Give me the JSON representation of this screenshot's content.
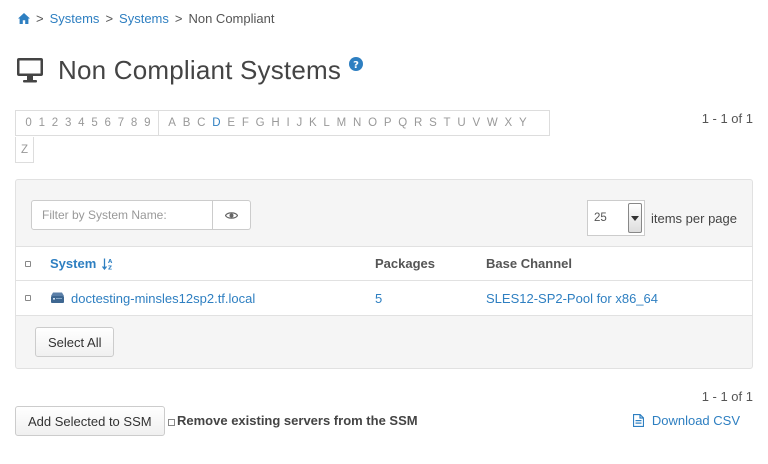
{
  "breadcrumb": {
    "home_icon": "home-icon",
    "sep1": ">",
    "item1": "Systems",
    "sep2": ">",
    "item2": "Systems",
    "sep3": ">",
    "current": "Non Compliant"
  },
  "header": {
    "icon": "desktop-icon",
    "title": "Non Compliant Systems",
    "help_icon": "question-circle-icon"
  },
  "alphabar": {
    "digits": [
      "0",
      "1",
      "2",
      "3",
      "4",
      "5",
      "6",
      "7",
      "8",
      "9"
    ],
    "letters": [
      "A",
      "B",
      "C",
      "D",
      "E",
      "F",
      "G",
      "H",
      "I",
      "J",
      "K",
      "L",
      "M",
      "N",
      "O",
      "P",
      "Q",
      "R",
      "S",
      "T",
      "U",
      "V",
      "W",
      "X",
      "Y"
    ],
    "overflow": "Z",
    "active": "D"
  },
  "pager": {
    "top": "1 - 1 of 1",
    "bottom": "1 - 1 of 1"
  },
  "filter": {
    "placeholder": "Filter by System Name:",
    "icon": "eye-icon"
  },
  "per_page": {
    "value": "25",
    "label": "items per page"
  },
  "table": {
    "columns": {
      "system": "System",
      "packages": "Packages",
      "base_channel": "Base Channel"
    },
    "sort_icon": "sort-alpha-asc-icon",
    "rows": [
      {
        "system": "doctesting-minsles12sp2.tf.local",
        "packages": "5",
        "base_channel": "SLES12-SP2-Pool for x86_64",
        "icon": "server-icon"
      }
    ]
  },
  "buttons": {
    "select_all": "Select All",
    "add_ssm": "Add Selected to SSM",
    "remove_ssm": "Remove existing servers from the SSM",
    "download_csv": "Download CSV"
  },
  "colors": {
    "link": "#2e7fc1",
    "panel_bg": "#f5f5f5",
    "border": "#e1e1e1"
  }
}
